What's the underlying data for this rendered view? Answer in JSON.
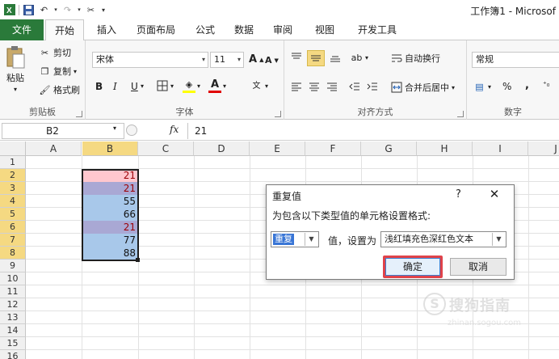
{
  "window": {
    "title": "工作簿1 - Microsof"
  },
  "colors": {
    "file_tab": "#2a7a3a",
    "sel_header": "#f5d982",
    "dup_fill": "#ffc7ce",
    "dup_text": "#9c0006",
    "col_b_fill": "#a8c8ea",
    "ok_highlight": "#e0434a"
  },
  "tabs": [
    "文件",
    "开始",
    "插入",
    "页面布局",
    "公式",
    "数据",
    "审阅",
    "视图",
    "开发工具"
  ],
  "ribbon": {
    "clipboard": {
      "paste": "粘贴",
      "cut": "剪切",
      "copy": "复制",
      "format_painter": "格式刷",
      "label": "剪贴板"
    },
    "font": {
      "name": "宋体",
      "size": "11",
      "grow": "A",
      "shrink": "A",
      "bold": "B",
      "italic": "I",
      "underline": "U",
      "font_color": "A",
      "label": "字体"
    },
    "alignment": {
      "wrap": "自动换行",
      "merge": "合并后居中",
      "label": "对齐方式"
    },
    "number": {
      "format": "常规",
      "percent": "%",
      "comma": ",",
      "label": "数字"
    }
  },
  "formula_bar": {
    "name_box": "B2",
    "fx": "fx",
    "value": "21"
  },
  "columns": [
    "A",
    "B",
    "C",
    "D",
    "E",
    "F",
    "G",
    "H",
    "I",
    "J"
  ],
  "rows": [
    "1",
    "2",
    "3",
    "4",
    "5",
    "6",
    "7",
    "8",
    "9",
    "10",
    "11",
    "12",
    "13",
    "14",
    "15",
    "16"
  ],
  "cells": [
    {
      "row": 2,
      "value": "21",
      "dup": true
    },
    {
      "row": 3,
      "value": "21",
      "dup": true
    },
    {
      "row": 4,
      "value": "55",
      "dup": false
    },
    {
      "row": 5,
      "value": "66",
      "dup": false
    },
    {
      "row": 6,
      "value": "21",
      "dup": true
    },
    {
      "row": 7,
      "value": "77",
      "dup": false
    },
    {
      "row": 8,
      "value": "88",
      "dup": false
    }
  ],
  "dialog": {
    "title": "重复值",
    "help": "?",
    "close": "✕",
    "message": "为包含以下类型值的单元格设置格式:",
    "type_value": "重复",
    "set_label": "值，设置为",
    "format_value": "浅红填充色深红色文本",
    "ok": "确定",
    "cancel": "取消"
  },
  "watermark": {
    "text": "搜狗指南",
    "url": "zhinan.sogou.com"
  }
}
